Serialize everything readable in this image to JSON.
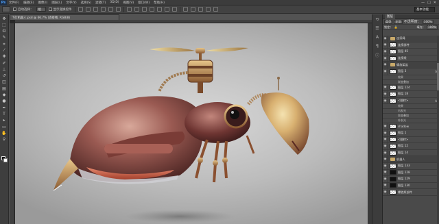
{
  "app": {
    "logo": "Ps"
  },
  "menu": [
    "文件(F)",
    "编辑(E)",
    "图像(I)",
    "图层(L)",
    "文字(Y)",
    "选择(S)",
    "滤镜(T)",
    "3D(D)",
    "视图(V)",
    "窗口(W)",
    "帮助(H)"
  ],
  "window_controls": [
    "—",
    "□",
    "✕"
  ],
  "options": {
    "auto_select_label": "自动选择：",
    "auto_select_target": "组",
    "transform_label": "显示变换控件"
  },
  "workspace": {
    "label": "基本功能"
  },
  "document": {
    "tab_title": "飞行机器人.psd @ 66.7% (连接绳, RGB/8)"
  },
  "layers_panel": {
    "tab_label": "图层",
    "filter": "类型",
    "blend_mode": "正常",
    "opacity_label": "不透明度：",
    "opacity_value": "100%",
    "lock_label": "锁定：",
    "fill_label": "填充：",
    "fill_value": "100%",
    "rows": [
      {
        "kind": "group",
        "label": "连接绳"
      },
      {
        "kind": "layer",
        "label": "连接部件"
      },
      {
        "kind": "layer",
        "label": "图层 45"
      },
      {
        "kind": "layer",
        "label": "连接线"
      },
      {
        "kind": "group",
        "label": "螺旋桨盖"
      },
      {
        "kind": "layer",
        "label": "图层 3",
        "fx": "fx"
      },
      {
        "kind": "fx",
        "label": "效果"
      },
      {
        "kind": "fx",
        "label": "渐变叠加"
      },
      {
        "kind": "layer",
        "label": "图层 124"
      },
      {
        "kind": "layer",
        "label": "图层 18"
      },
      {
        "kind": "layer",
        "label": "<翻转>",
        "fx": "fx"
      },
      {
        "kind": "fx",
        "label": "效果"
      },
      {
        "kind": "fx",
        "label": "内发光"
      },
      {
        "kind": "fx",
        "label": "渐变叠加"
      },
      {
        "kind": "fx",
        "label": "外发光"
      },
      {
        "kind": "layer",
        "label": "shadow"
      },
      {
        "kind": "layer",
        "label": "图层 1"
      },
      {
        "kind": "layer",
        "label": "<翻转>"
      },
      {
        "kind": "layer",
        "label": "图层 12"
      },
      {
        "kind": "layer",
        "label": "图层 14"
      },
      {
        "kind": "group",
        "label": "机器人"
      },
      {
        "kind": "layer",
        "label": "图层 133"
      },
      {
        "kind": "layer",
        "label": "图层 128",
        "dark": true
      },
      {
        "kind": "layer",
        "label": "图层 129",
        "dark": true
      },
      {
        "kind": "layer",
        "label": "图层 130",
        "dark": true
      },
      {
        "kind": "layer",
        "label": "螺旋桨部件"
      }
    ]
  }
}
